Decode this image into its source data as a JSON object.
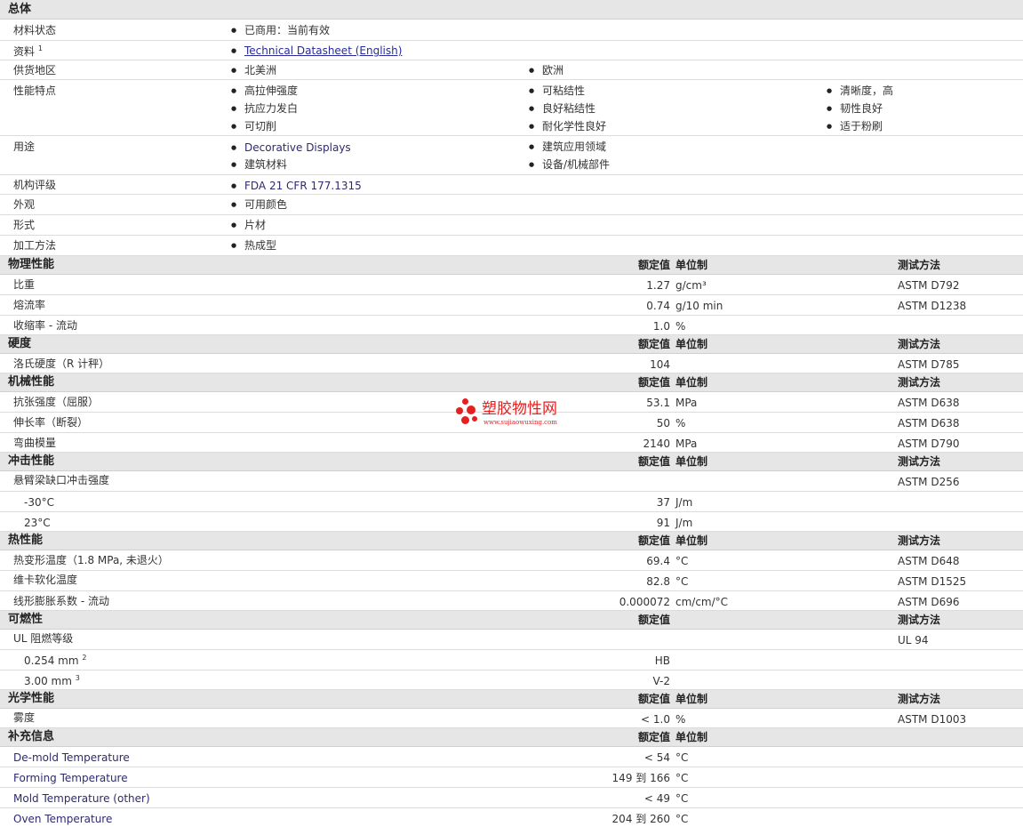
{
  "general": {
    "title": "总体",
    "status_label": "材料状态",
    "status_value": "已商用：当前有效",
    "docs_label": "资料",
    "docs_sup": "1",
    "docs_link": "Technical Datasheet (English)",
    "supply_label": "供货地区",
    "supply": [
      "北美洲",
      "欧洲"
    ],
    "features_label": "性能特点",
    "features": [
      "高拉伸强度",
      "可粘结性",
      "清晰度，高",
      "抗应力发白",
      "良好粘结性",
      "韧性良好",
      "可切削",
      "耐化学性良好",
      "适于粉刷"
    ],
    "uses_label": "用途",
    "uses": [
      "Decorative Displays",
      "建筑应用领域",
      "建筑材料",
      "设备/机械部件"
    ],
    "rating_label": "机构评级",
    "rating": "FDA 21 CFR 177.1315",
    "appearance_label": "外观",
    "appearance": "可用颜色",
    "form_label": "形式",
    "form": "片材",
    "processing_label": "加工方法",
    "processing": "热成型"
  },
  "headers": {
    "value": "额定值",
    "unit": "单位制",
    "method": "测试方法"
  },
  "sections": {
    "physical": {
      "title": "物理性能",
      "rows": [
        {
          "label": "比重",
          "value": "1.27",
          "unit": "g/cm³",
          "method": "ASTM D792"
        },
        {
          "label": "熔流率",
          "value": "0.74",
          "unit": "g/10 min",
          "method": "ASTM D1238"
        },
        {
          "label": "收缩率  - 流动",
          "value": "1.0",
          "unit": "%",
          "method": ""
        }
      ]
    },
    "hardness": {
      "title": "硬度",
      "rows": [
        {
          "label": "洛氏硬度（R 计秤）",
          "value": "104",
          "unit": "",
          "method": "ASTM D785"
        }
      ]
    },
    "mechanical": {
      "title": "机械性能",
      "rows": [
        {
          "label": "抗张强度（屈服）",
          "value": "53.1",
          "unit": "MPa",
          "method": "ASTM D638"
        },
        {
          "label": "伸长率（断裂）",
          "value": "50",
          "unit": "%",
          "method": "ASTM D638"
        },
        {
          "label": "弯曲模量",
          "value": "2140",
          "unit": "MPa",
          "method": "ASTM D790"
        }
      ]
    },
    "impact": {
      "title": "冲击性能",
      "rows": [
        {
          "label": "悬臂梁缺口冲击强度",
          "value": "",
          "unit": "",
          "method": "ASTM D256"
        },
        {
          "label": "-30°C",
          "value": "37",
          "unit": "J/m",
          "method": ""
        },
        {
          "label": "23°C",
          "value": "91",
          "unit": "J/m",
          "method": ""
        }
      ]
    },
    "thermal": {
      "title": "热性能",
      "rows": [
        {
          "label": "热变形温度（1.8 MPa, 未退火）",
          "value": "69.4",
          "unit": "°C",
          "method": "ASTM D648"
        },
        {
          "label": "维卡软化温度",
          "value": "82.8",
          "unit": "°C",
          "method": "ASTM D1525"
        },
        {
          "label": "线形膨胀系数  - 流动",
          "value": "0.000072",
          "unit": "cm/cm/°C",
          "method": "ASTM D696"
        }
      ]
    },
    "flammability": {
      "title": "可燃性",
      "rows": [
        {
          "label": "UL 阻燃等级",
          "value": "",
          "method": "UL 94"
        },
        {
          "label": "0.254 mm",
          "sup": "2",
          "value": "HB",
          "method": ""
        },
        {
          "label": "3.00 mm",
          "sup": "3",
          "value": "V-2",
          "method": ""
        }
      ]
    },
    "optical": {
      "title": "光学性能",
      "rows": [
        {
          "label": "雾度",
          "value": "< 1.0",
          "unit": "%",
          "method": "ASTM D1003"
        }
      ]
    },
    "extra": {
      "title": "补充信息",
      "rows": [
        {
          "label": "De-mold Temperature",
          "value": "< 54",
          "unit": "°C"
        },
        {
          "label": "Forming Temperature",
          "value": "149 到  166",
          "unit": "°C"
        },
        {
          "label": "Mold Temperature (other)",
          "value": "< 49",
          "unit": "°C"
        },
        {
          "label": "Oven Temperature",
          "value": "204 到  260",
          "unit": "°C"
        }
      ]
    }
  },
  "watermark": {
    "text": "塑胶物性网",
    "url": "www.sujiaowuxing.com",
    "color": "#e62020"
  }
}
